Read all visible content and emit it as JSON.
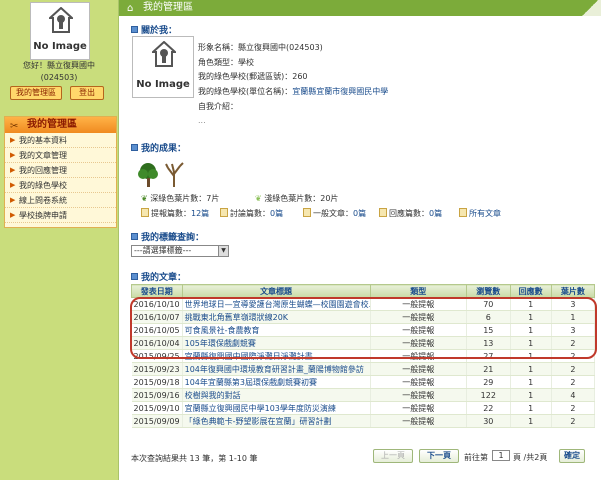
{
  "sidebar": {
    "avatar_text": "No Image",
    "greeting": "您好！縣立復興國中",
    "user_code": "(024503)",
    "btn_my_area": "我的管理區",
    "btn_logout": "登出",
    "menu_title": "我的管理區",
    "menu_items": [
      "我的基本資料",
      "我的文章管理",
      "我的回應管理",
      "我的綠色學校",
      "線上問卷系統",
      "學校換牌申請"
    ]
  },
  "main": {
    "header_title": "我的管理區",
    "about": {
      "title": "關於我：",
      "avatar_text": "No Image",
      "rows": [
        "形象名稱：縣立復興國中(024503)",
        "角色類型：學校",
        "我的綠色學校(郵遞區號)：260"
      ],
      "school_label": "我的綠色學校(單位名稱)：",
      "school_link": "宜蘭縣宜蘭市復興國民中學",
      "intro_label": "自我介紹：",
      "intro_value": "..."
    },
    "achievements": {
      "title": "我的成果：",
      "deep_leaf": "深綠色葉片數：7片",
      "light_leaf": "淺綠色葉片數：20片",
      "report_label": "提報篇數：",
      "report_value": "12篇",
      "discuss_label": "討論篇數：",
      "discuss_value": "0篇",
      "general_label": "一般文章：",
      "general_value": "0篇",
      "reply_label": "回應篇數：",
      "reply_value": "0篇",
      "all_articles": "所有文章"
    },
    "tags": {
      "title": "我的標籤查詢：",
      "select_value": "---請選擇標籤---"
    },
    "articles": {
      "title": "我的文章：",
      "headers": [
        "發表日期",
        "文章標題",
        "類型",
        "瀏覽數",
        "回應數",
        "葉片數"
      ],
      "rows": [
        [
          "2016/10/10",
          "世界地球日—宜導愛護台灣原生蝴蝶—校園園遊會校...",
          "一般提報",
          "70",
          "1",
          "3"
        ],
        [
          "2016/10/07",
          "挑戰東北角舊草嶺環狀線20K",
          "一般提報",
          "6",
          "1",
          "1"
        ],
        [
          "2016/10/05",
          "可食風景社-食農教育",
          "一般提報",
          "15",
          "1",
          "3"
        ],
        [
          "2016/10/04",
          "105年環保戲劇競賽",
          "一般提報",
          "13",
          "1",
          "2"
        ],
        [
          "2015/09/25",
          "宜蘭縣復興國中國際淨灘日淨灘計畫",
          "一般提報",
          "27",
          "1",
          "2"
        ],
        [
          "2015/09/23",
          "104年復興國中環境教育研習計畫_蘭陽博物館參訪",
          "一般提報",
          "21",
          "1",
          "2"
        ],
        [
          "2015/09/18",
          "104年宜蘭縣第3屆環保戲劇競賽初賽",
          "一般提報",
          "29",
          "1",
          "2"
        ],
        [
          "2015/09/16",
          "校樹與我的對話",
          "一般提報",
          "122",
          "1",
          "4"
        ],
        [
          "2015/09/10",
          "宜蘭縣立復興國民中學103學年度防災演練",
          "一般提報",
          "22",
          "1",
          "2"
        ],
        [
          "2015/09/09",
          "「綠色典範卡-野望影展在宜蘭」研習計劃",
          "一般提報",
          "30",
          "1",
          "2"
        ]
      ]
    },
    "footer": {
      "summary": "本次查詢結果共 13 筆，第 1-10 筆",
      "prev": "上一頁",
      "next": "下一頁",
      "goto_label": "前往第",
      "page_value": "1",
      "page_total": "頁 /共2頁",
      "confirm": "確定"
    }
  }
}
